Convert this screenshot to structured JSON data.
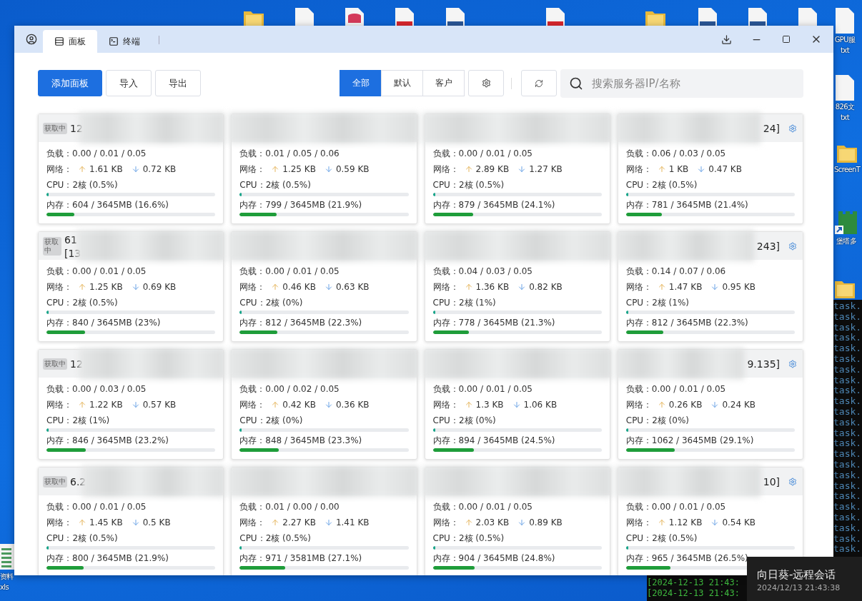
{
  "desktop": {
    "top_icons": [
      {
        "kind": "folder"
      },
      {
        "kind": "file"
      },
      {
        "kind": "database"
      },
      {
        "kind": "pdf"
      },
      {
        "kind": "word"
      },
      {
        "kind": "pdf"
      },
      {
        "kind": "folder"
      },
      {
        "kind": "word"
      },
      {
        "kind": "word"
      },
      {
        "kind": "file"
      }
    ],
    "side_icons": [
      {
        "kind": "file",
        "labels": [
          "GPU服",
          "txt"
        ]
      },
      {
        "kind": "file",
        "labels": [
          "826文",
          "txt"
        ]
      },
      {
        "kind": "folder",
        "labels": [
          "ScreenT"
        ]
      },
      {
        "kind": "app",
        "labels": [
          "堡塔多"
        ]
      },
      {
        "kind": "folder"
      },
      {
        "kind": "sheet",
        "labels": [
          "资料",
          "xls"
        ]
      }
    ]
  },
  "window": {
    "tabs": [
      {
        "label": "面板",
        "selected": true
      },
      {
        "label": "终端",
        "selected": false
      }
    ]
  },
  "toolbar": {
    "actions": [
      {
        "label": "添加面板",
        "kind": "primary"
      },
      {
        "label": "导入",
        "kind": "plain"
      },
      {
        "label": "导出",
        "kind": "plain"
      }
    ],
    "filters": [
      {
        "label": "全部",
        "selected": true
      },
      {
        "label": "默认",
        "selected": false
      },
      {
        "label": "客户",
        "selected": false
      }
    ],
    "search": {
      "placeholder": "搜索服务器IP/名称"
    }
  },
  "rows": [
    {
      "cards": [
        {
          "badge": "获取中",
          "title": [
            "12"
          ],
          "load": "负载：0.00 / 0.01 / 0.05",
          "net_label": "网络：",
          "up": "1.61 KB",
          "down": "0.72 KB",
          "cpu": {
            "text": "CPU：2核 (0.5%)",
            "level": 0.005
          },
          "mem": {
            "text": "内存：604 / 3645MB (16.6%)",
            "level": 0.166
          }
        },
        {
          "load": "负载：0.01 / 0.05 / 0.06",
          "net_label": "网络：",
          "up": "1.25 KB",
          "down": "0.59 KB",
          "cpu": {
            "text": "CPU：2核 (0.5%)",
            "level": 0.005
          },
          "mem": {
            "text": "内存：799 / 3645MB (21.9%)",
            "level": 0.219
          }
        },
        {
          "load": "负载：0.00 / 0.01 / 0.05",
          "net_label": "网络：",
          "up": "2.89 KB",
          "down": "1.27 KB",
          "cpu": {
            "text": "CPU：2核 (0.5%)",
            "level": 0.005
          },
          "mem": {
            "text": "内存：879 / 3645MB (24.1%)",
            "level": 0.241
          }
        },
        {
          "tail": "24]",
          "settings": true,
          "load": "负载：0.06 / 0.03 / 0.05",
          "net_label": "网络：",
          "up": "1 KB",
          "down": "0.47 KB",
          "cpu": {
            "text": "CPU：2核 (0.5%)",
            "level": 0.005
          },
          "mem": {
            "text": "内存：781 / 3645MB (21.4%)",
            "level": 0.214
          }
        }
      ]
    },
    {
      "cards": [
        {
          "badge": "获取中",
          "title": [
            "61",
            "[13"
          ],
          "load": "负载：0.00 / 0.01 / 0.05",
          "net_label": "网络：",
          "up": "1.25 KB",
          "down": "0.69 KB",
          "cpu": {
            "text": "CPU：2核 (0.5%)",
            "level": 0.005
          },
          "mem": {
            "text": "内存：840 / 3645MB (23%)",
            "level": 0.23
          }
        },
        {
          "load": "负载：0.00 / 0.01 / 0.05",
          "net_label": "网络：",
          "up": "0.46 KB",
          "down": "0.63 KB",
          "cpu": {
            "text": "CPU：2核 (0%)",
            "level": 0
          },
          "mem": {
            "text": "内存：812 / 3645MB (22.3%)",
            "level": 0.223
          }
        },
        {
          "load": "负载：0.04 / 0.03 / 0.05",
          "net_label": "网络：",
          "up": "1.36 KB",
          "down": "0.82 KB",
          "cpu": {
            "text": "CPU：2核 (1%)",
            "level": 0.01
          },
          "mem": {
            "text": "内存：778 / 3645MB (21.3%)",
            "level": 0.213
          }
        },
        {
          "tail": "243]",
          "settings": true,
          "load": "负载：0.14 / 0.07 / 0.06",
          "net_label": "网络：",
          "up": "1.47 KB",
          "down": "0.95 KB",
          "cpu": {
            "text": "CPU：2核 (1%)",
            "level": 0.01
          },
          "mem": {
            "text": "内存：812 / 3645MB (22.3%)",
            "level": 0.223
          }
        }
      ]
    },
    {
      "cards": [
        {
          "badge": "获取中",
          "title": [
            "12"
          ],
          "load": "负载：0.00 / 0.03 / 0.05",
          "net_label": "网络：",
          "up": "1.22 KB",
          "down": "0.57 KB",
          "cpu": {
            "text": "CPU：2核 (1%)",
            "level": 0.01
          },
          "mem": {
            "text": "内存：846 / 3645MB (23.2%)",
            "level": 0.232
          }
        },
        {
          "load": "负载：0.00 / 0.02 / 0.05",
          "net_label": "网络：",
          "up": "0.42 KB",
          "down": "0.36 KB",
          "cpu": {
            "text": "CPU：2核 (0%)",
            "level": 0
          },
          "mem": {
            "text": "内存：848 / 3645MB (23.3%)",
            "level": 0.233
          }
        },
        {
          "load": "负载：0.00 / 0.01 / 0.05",
          "net_label": "网络：",
          "up": "1.3 KB",
          "down": "1.06 KB",
          "cpu": {
            "text": "CPU：2核 (0%)",
            "level": 0
          },
          "mem": {
            "text": "内存：894 / 3645MB (24.5%)",
            "level": 0.245
          }
        },
        {
          "tail": "9.135]",
          "settings": true,
          "load": "负载：0.00 / 0.01 / 0.05",
          "net_label": "网络：",
          "up": "0.26 KB",
          "down": "0.24 KB",
          "cpu": {
            "text": "CPU：2核 (0%)",
            "level": 0
          },
          "mem": {
            "text": "内存：1062 / 3645MB (29.1%)",
            "level": 0.291
          }
        }
      ]
    },
    {
      "cards": [
        {
          "badge": "获取中",
          "title": [
            "6.2"
          ],
          "load": "负载：0.00 / 0.01 / 0.05",
          "net_label": "网络：",
          "up": "1.45 KB",
          "down": "0.5 KB",
          "cpu": {
            "text": "CPU：2核 (0.5%)",
            "level": 0.005
          },
          "mem": {
            "text": "内存：800 / 3645MB (21.9%)",
            "level": 0.219
          }
        },
        {
          "load": "负载：0.01 / 0.00 / 0.00",
          "net_label": "网络：",
          "up": "2.27 KB",
          "down": "1.41 KB",
          "cpu": {
            "text": "CPU：2核 (0.5%)",
            "level": 0.005
          },
          "mem": {
            "text": "内存：971 / 3581MB (27.1%)",
            "level": 0.271
          }
        },
        {
          "load": "负载：0.00 / 0.01 / 0.05",
          "net_label": "网络：",
          "up": "2.03 KB",
          "down": "0.89 KB",
          "cpu": {
            "text": "CPU：2核 (0.5%)",
            "level": 0.005
          },
          "mem": {
            "text": "内存：904 / 3645MB (24.8%)",
            "level": 0.248
          }
        },
        {
          "tail": "10]",
          "settings": true,
          "load": "负载：0.00 / 0.01 / 0.05",
          "net_label": "网络：",
          "up": "1.12 KB",
          "down": "0.54 KB",
          "cpu": {
            "text": "CPU：2核 (0.5%)",
            "level": 0.005
          },
          "mem": {
            "text": "内存：965 / 3645MB (26.5%)",
            "level": 0.265
          }
        }
      ]
    }
  ],
  "terminal": {
    "lines": [
      "task.",
      "task.",
      "task.",
      "task.",
      "task.",
      "task.",
      "task.",
      "task.",
      "task.",
      "task.",
      "task.",
      "task.",
      "task.",
      "task.",
      "task.",
      "task.",
      "task.",
      "task.",
      "task.",
      "task.",
      "task.",
      "task.",
      "task.",
      "task."
    ]
  },
  "log": {
    "lines": [
      "[2024-12-13 21:43:",
      "[2024-12-13 21:43:"
    ]
  },
  "toast": {
    "title": "向日葵-远程会话",
    "time": "2024/12/13 21:43:38"
  }
}
